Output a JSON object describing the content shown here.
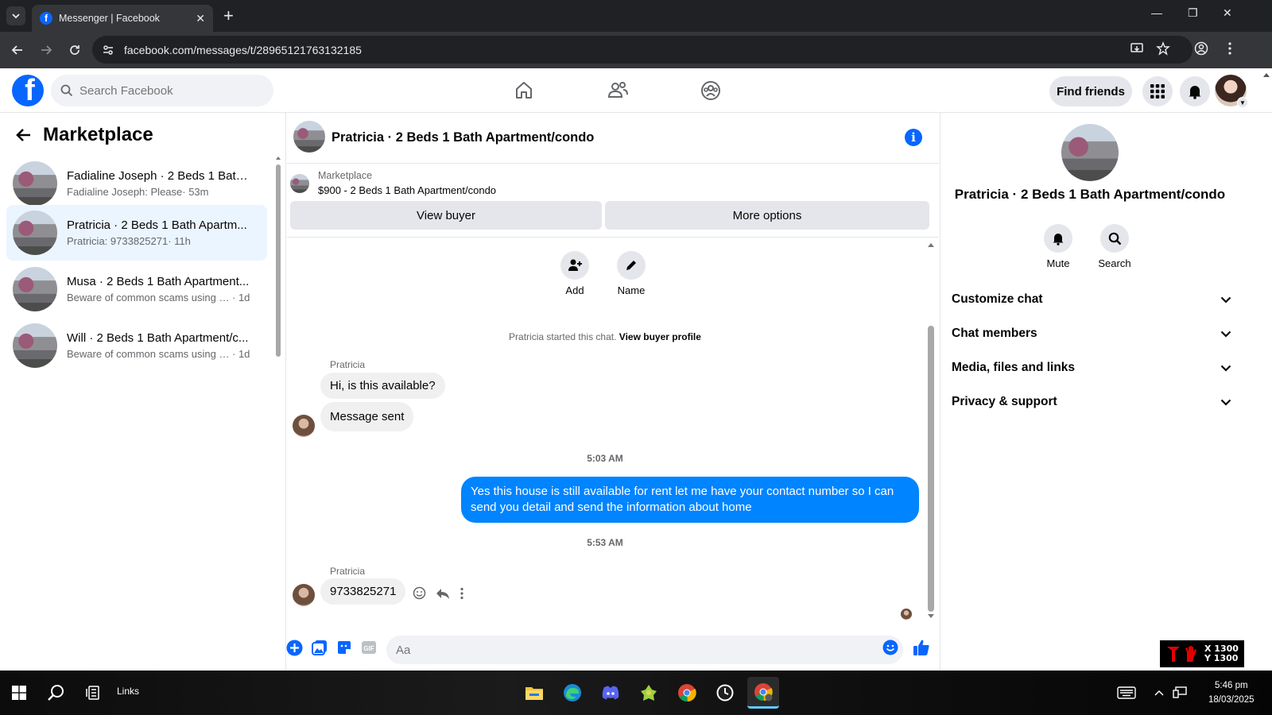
{
  "browser": {
    "tab_title": "Messenger | Facebook",
    "url": "facebook.com/messages/t/28965121763132185"
  },
  "header": {
    "search_placeholder": "Search Facebook",
    "find_friends": "Find friends"
  },
  "sidebar": {
    "title": "Marketplace",
    "conversations": [
      {
        "name": "Fadialine Joseph · 2 Beds 1 Bath ...",
        "preview": "Fadialine Joseph: Please",
        "time": "· 53m"
      },
      {
        "name": "Pratricia · 2 Beds 1 Bath Apartm...",
        "preview": "Pratricia: 9733825271",
        "time": "· 11h"
      },
      {
        "name": "Musa · 2 Beds 1 Bath Apartment...",
        "preview": "Beware of common scams using pa...",
        "time": "· 1d"
      },
      {
        "name": "Will · 2 Beds 1 Bath Apartment/c...",
        "preview": "Beware of common scams using pa...",
        "time": "· 1d"
      }
    ]
  },
  "chat": {
    "title": "Pratricia · 2 Beds 1 Bath Apartment/condo",
    "listing_source": "Marketplace",
    "listing_price": "$900 - 2 Beds 1 Bath Apartment/condo",
    "view_buyer": "View buyer",
    "more_options": "More options",
    "quick_add": "Add",
    "quick_name": "Name",
    "started_text": "Pratricia started this chat.",
    "view_buyer_profile": "View buyer profile",
    "sender_name": "Pratricia",
    "msg1": "Hi, is this available?",
    "msg2": "Message sent",
    "time1": "5:03 AM",
    "msg_out": "Yes this house is still available for rent let me have your contact number so I can send you detail and send the information about home",
    "time2": "5:53 AM",
    "sender_name2": "Pratricia",
    "msg3": "9733825271",
    "composer_placeholder": "Aa"
  },
  "details": {
    "title": "Pratricia · 2 Beds 1 Bath Apartment/condo",
    "mute": "Mute",
    "search": "Search",
    "sections": [
      "Customize chat",
      "Chat members",
      "Media, files and links",
      "Privacy & support"
    ]
  },
  "overlay": {
    "x": "X 1300",
    "y": "Y 1300"
  },
  "taskbar": {
    "links": "Links",
    "time": "5:46 pm",
    "date": "18/03/2025"
  },
  "colors": {
    "fb_blue": "#0866ff",
    "messenger_blue": "#0084ff",
    "active_row": "#ebf5ff"
  }
}
